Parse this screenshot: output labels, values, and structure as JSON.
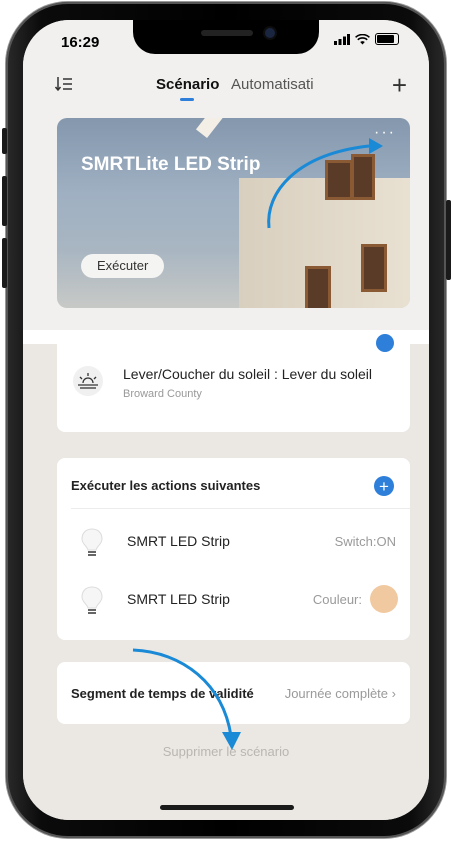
{
  "status_bar": {
    "time": "16:29"
  },
  "nav": {
    "sort_icon": "sort-list-icon",
    "tabs": [
      {
        "label": "Scénario",
        "active": true
      },
      {
        "label": "Automatisati",
        "active": false
      }
    ],
    "add_icon": "plus-icon",
    "accent_color": "#2d7fd9"
  },
  "scene_card": {
    "title": "SMRTLite LED Strip",
    "more_icon": "ellipsis-icon",
    "execute_label": "Exécuter"
  },
  "condition": {
    "icon": "sunrise-icon",
    "title": "Lever/Coucher du soleil : Lever du soleil",
    "location": "Broward County"
  },
  "actions": {
    "header": "Exécuter les actions suivantes",
    "items": [
      {
        "icon": "bulb-icon",
        "name": "SMRT LED Strip",
        "value": "Switch:ON"
      },
      {
        "icon": "bulb-icon",
        "name": "SMRT LED Strip",
        "value": "Couleur:",
        "swatch": "#f1c9a0"
      }
    ]
  },
  "validity": {
    "label": "Segment de temps de validité",
    "value": "Journée complète"
  },
  "delete_label": "Supprimer le scénario"
}
